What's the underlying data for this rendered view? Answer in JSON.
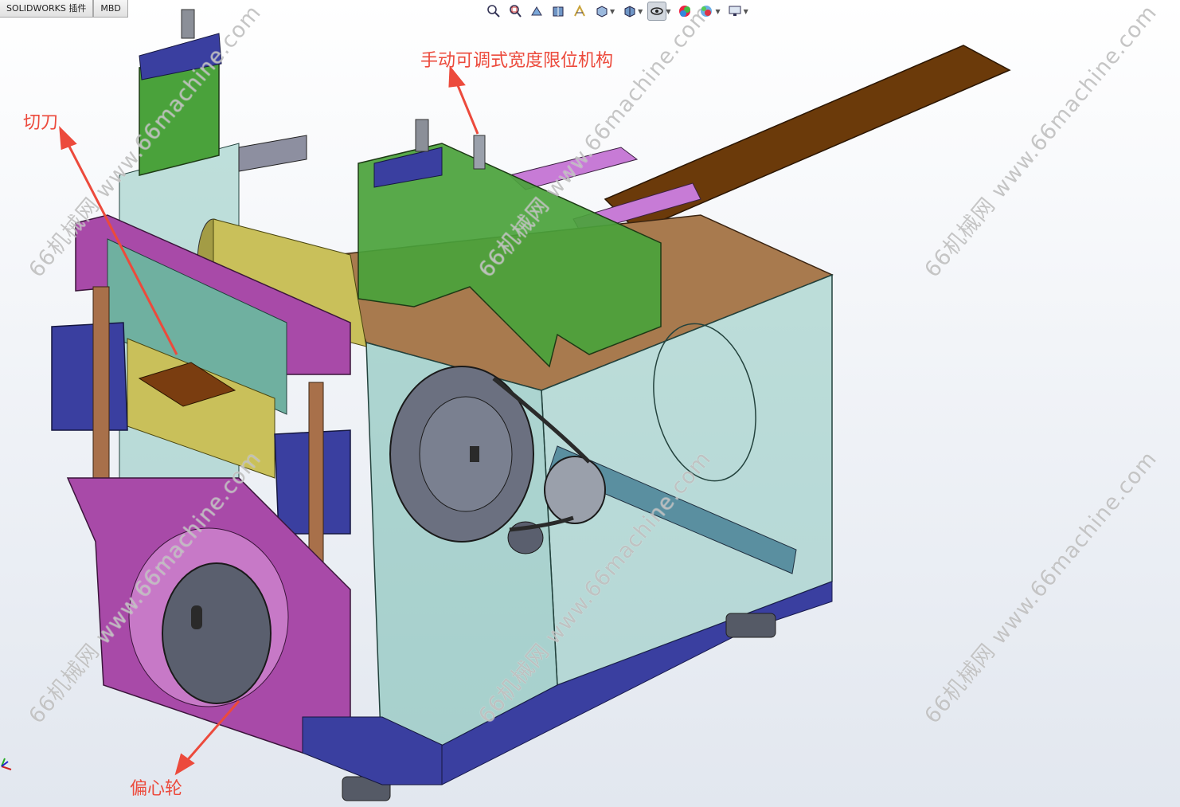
{
  "tabs": [
    "SOLIDWORKS 插件",
    "MBD"
  ],
  "hud_icons": [
    "zoom-to-fit-icon",
    "zoom-area-icon",
    "previous-view-icon",
    "section-view-icon",
    "dynamic-annotation-icon",
    "view-orientation-icon",
    "display-style-icon",
    "hide-show-items-icon",
    "edit-appearance-icon",
    "apply-scene-icon",
    "view-settings-icon"
  ],
  "callouts": {
    "top": "手动可调式宽度限位机构",
    "knife": "切刀",
    "cam": "偏心轮"
  },
  "watermarks": [
    "66机械网 www.66machine.com",
    "66机械网 www.66machine.com",
    "66机械网 www.66machine.com",
    "66机械网 www.66machine.com",
    "66机械网 www.66machine.com",
    "66机械网 www.66machine.com"
  ],
  "colors": {
    "callout": "#ec4a3c",
    "green": "#4aa23b",
    "magenta": "#a84aa8",
    "navy": "#3a3fa0",
    "tan": "#a87a4e",
    "strip": "#6b3a0a",
    "glass": "#7fc0b6",
    "gold": "#c9c05a"
  }
}
